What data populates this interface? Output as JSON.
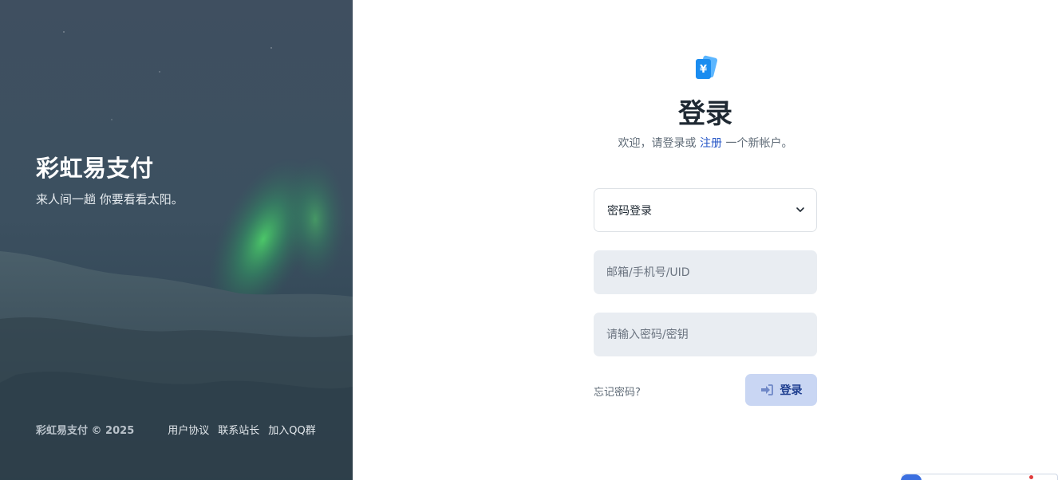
{
  "hero": {
    "title": "彩虹易支付",
    "subtitle": "来人间一趟 你要看看太阳。",
    "footer": {
      "copyright": "彩虹易支付 © 2025",
      "links": [
        "用户协议",
        "联系站长",
        "加入QQ群"
      ]
    }
  },
  "login": {
    "logo_icon": "yuan-wallet-icon",
    "title": "登录",
    "subtitle_prefix": "欢迎，请登录或 ",
    "register_link": "注册",
    "subtitle_suffix": " 一个新帐户。",
    "method_select": {
      "value": "密码登录"
    },
    "username": {
      "placeholder": "邮箱/手机号/UID",
      "value": ""
    },
    "password": {
      "placeholder": "请输入密码/密钥",
      "value": ""
    },
    "forgot_link": "忘记密码?",
    "submit_label": "登录"
  },
  "colors": {
    "accent": "#1a8cf0",
    "link": "#2757c7",
    "button_bg": "#c9d6f3",
    "button_text": "#1d3d8f",
    "field_bg": "#e9edf2"
  }
}
